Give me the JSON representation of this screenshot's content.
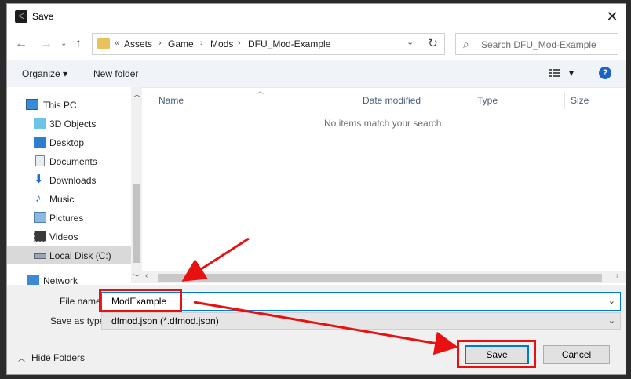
{
  "window": {
    "title": "Save"
  },
  "nav": {
    "back": "←",
    "forward": "→",
    "up": "↑"
  },
  "address": {
    "overflow": "«",
    "crumbs": [
      "Assets",
      "Game",
      "Mods",
      "DFU_Mod-Example"
    ],
    "sep": "›",
    "dropdown": "⌄",
    "refresh": "↻"
  },
  "search": {
    "placeholder": "Search DFU_Mod-Example"
  },
  "toolbar": {
    "organize": "Organize ▾",
    "new_folder": "New folder",
    "view": "▾",
    "help": "?"
  },
  "sidebar": {
    "items": [
      {
        "label": "This PC",
        "icon": "pc-icon"
      },
      {
        "label": "3D Objects",
        "icon": "cube-icon"
      },
      {
        "label": "Desktop",
        "icon": "desktop-icon"
      },
      {
        "label": "Documents",
        "icon": "document-icon"
      },
      {
        "label": "Downloads",
        "icon": "download-icon"
      },
      {
        "label": "Music",
        "icon": "music-icon"
      },
      {
        "label": "Pictures",
        "icon": "picture-icon"
      },
      {
        "label": "Videos",
        "icon": "video-icon"
      },
      {
        "label": "Local Disk (C:)",
        "icon": "disk-icon"
      },
      {
        "label": "Network",
        "icon": "network-icon"
      }
    ]
  },
  "list": {
    "columns": [
      "Name",
      "Date modified",
      "Type",
      "Size"
    ],
    "empty_message": "No items match your search."
  },
  "form": {
    "file_name_label": "File name",
    "file_name_value": "ModExample",
    "save_as_type_label": "Save as type:",
    "save_as_type_value": "dfmod.json (*.dfmod.json)"
  },
  "footer": {
    "hide_folders": "Hide Folders",
    "save": "Save",
    "cancel": "Cancel"
  },
  "colors": {
    "annotation": "#e81010",
    "accent": "#0078d7"
  }
}
